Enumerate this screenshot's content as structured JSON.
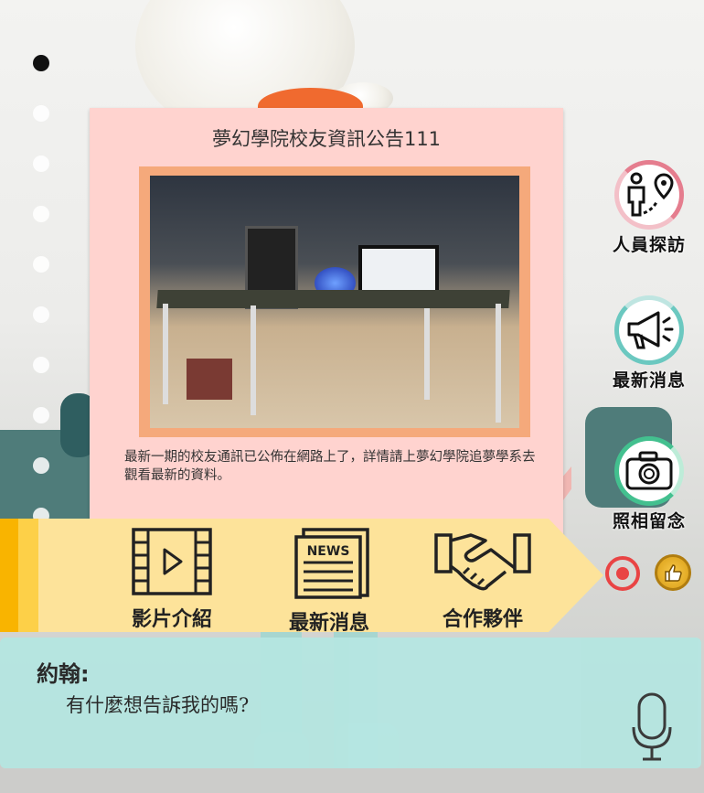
{
  "card": {
    "title": "夢幻學院校友資訊公告111",
    "body": "最新一期的校友通訊已公佈在網路上了，詳情請上夢幻學院追夢學系去觀看最新的資料。"
  },
  "side_menu": [
    {
      "label": "人員探訪",
      "icon": "person-location-icon"
    },
    {
      "label": "最新消息",
      "icon": "megaphone-icon"
    },
    {
      "label": "照相留念",
      "icon": "camera-icon"
    }
  ],
  "bottom_nav": [
    {
      "label": "影片介紹",
      "icon": "video-film-icon"
    },
    {
      "label": "最新消息",
      "icon": "newspaper-icon",
      "badge": "NEWS"
    },
    {
      "label": "合作夥伴",
      "icon": "handshake-icon"
    }
  ],
  "dialog": {
    "speaker": "約翰:",
    "message": "有什麼想告訴我的嗎?"
  },
  "colors": {
    "card_bg": "#ffd3cf",
    "nav_bg": "#fde39a",
    "dialog_bg": "#b5e6e1",
    "record_red": "#e94444"
  }
}
